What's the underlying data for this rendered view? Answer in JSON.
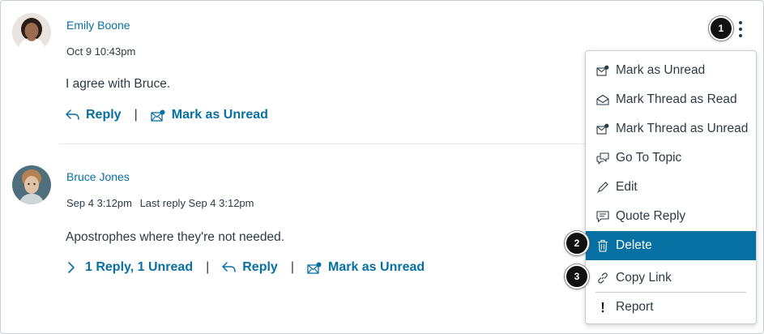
{
  "colors": {
    "link": "#0770a3",
    "text": "#2d3b45",
    "highlight": "#0770a3",
    "callout": "#111111"
  },
  "entries": [
    {
      "author": "Emily Boone",
      "date": "Oct 9 10:43pm",
      "last_reply": "",
      "message": "I agree with Bruce.",
      "actions": {
        "reply": "Reply",
        "mark_unread": "Mark as Unread"
      }
    },
    {
      "author": "Bruce Jones",
      "date": "Sep 4 3:12pm",
      "last_reply": "Last reply Sep 4 3:12pm",
      "message": "Apostrophes where they're not needed.",
      "actions": {
        "replies": "1 Reply, 1 Unread",
        "reply": "Reply",
        "mark_unread": "Mark as Unread"
      }
    }
  ],
  "separator": "|",
  "menu": {
    "items": [
      {
        "label": "Mark as Unread",
        "icon": "envelope-dot-icon"
      },
      {
        "label": "Mark Thread as Read",
        "icon": "envelope-open-icon"
      },
      {
        "label": "Mark Thread as Unread",
        "icon": "envelope-dot-icon"
      },
      {
        "label": "Go To Topic",
        "icon": "discussion-icon"
      },
      {
        "label": "Edit",
        "icon": "pencil-icon"
      },
      {
        "label": "Quote Reply",
        "icon": "quote-icon"
      },
      {
        "label": "Delete",
        "icon": "trash-icon",
        "highlighted": true
      },
      {
        "label": "Copy Link",
        "icon": "link-icon"
      },
      {
        "label": "Report",
        "icon": "exclamation-icon"
      }
    ]
  },
  "callouts": [
    "1",
    "2",
    "3"
  ]
}
